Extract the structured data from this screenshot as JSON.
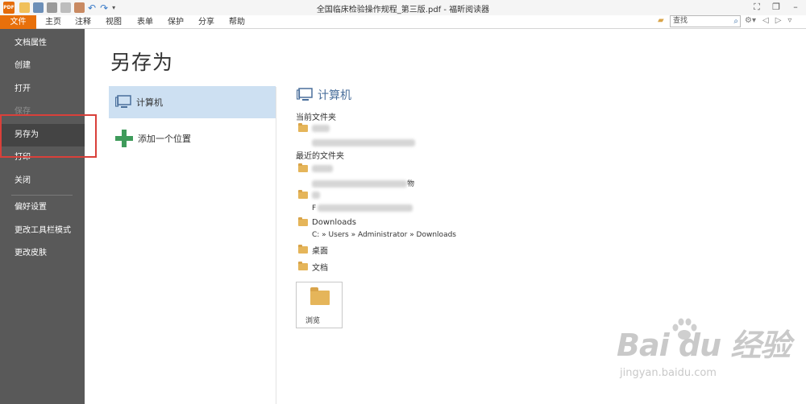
{
  "app": {
    "logo_text": "PDF",
    "title": "全国临床检验操作规程_第三版.pdf - 福昕阅读器"
  },
  "ribbon": {
    "tabs": [
      "文件",
      "主页",
      "注释",
      "视图",
      "表单",
      "保护",
      "分享",
      "帮助"
    ],
    "search_placeholder": "查找"
  },
  "sidebar": {
    "items": [
      "文档属性",
      "创建",
      "打开",
      "保存",
      "另存为",
      "打印",
      "关闭",
      "偏好设置",
      "更改工具栏模式",
      "更改皮肤"
    ],
    "active": "另存为"
  },
  "main": {
    "heading": "另存为",
    "places": [
      "计算机",
      "添加一个位置"
    ],
    "right_header": "计算机",
    "current_folder_label": "当前文件夹",
    "recent_folders_label": "最近的文件夹",
    "recent_item2_tail": "物",
    "recent_item3_prefix": "F",
    "downloads": {
      "name": "Downloads",
      "path": "C: » Users » Administrator » Downloads"
    },
    "desktop": "桌面",
    "documents": "文档",
    "browse": "浏览"
  },
  "watermark": {
    "brand": "Bai du 经验",
    "url": "jingyan.baidu.com"
  },
  "colors": {
    "accent": "#e8700b",
    "sidebar_bg": "#595959",
    "selected_place": "#cde0f2",
    "plus": "#3f9b5b",
    "highlight_box": "#d9403a"
  }
}
